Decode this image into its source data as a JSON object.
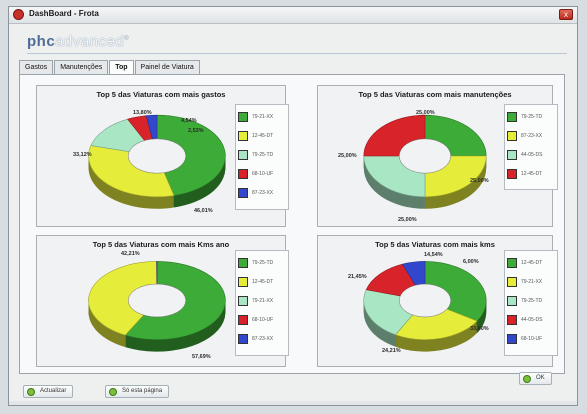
{
  "window": {
    "title": "DashBoard - Frota",
    "close_glyph": "x"
  },
  "logo": {
    "part1": "phc",
    "part2": "advanced",
    "mark": "®"
  },
  "tabs": [
    {
      "label": "Gastos",
      "active": false
    },
    {
      "label": "Manutenções",
      "active": false
    },
    {
      "label": "Top",
      "active": true
    },
    {
      "label": "Painel de Viatura",
      "active": false
    }
  ],
  "buttons": {
    "actualizar": "Actualizar",
    "so_esta_pagina": "Só esta página",
    "ok": "OK"
  },
  "icons": {
    "app": "app-logo-icon",
    "close": "close-icon",
    "button": "green-check-icon"
  },
  "chart_data": [
    {
      "type": "pie",
      "title": "Top 5 das Viaturas com mais gastos",
      "donut": true,
      "categories": [
        "79-21-XX",
        "12-45-DT",
        "79-25-TD",
        "68-10-UF",
        "87-23-XX"
      ],
      "values": [
        46.01,
        33.12,
        13.8,
        4.54,
        2.53
      ],
      "labels": [
        "46,01%",
        "33,12%",
        "13,80%",
        "4,54%",
        "2,53%"
      ],
      "colors": [
        "#3dab37",
        "#e6ec3a",
        "#a9e6c4",
        "#d8232a",
        "#3347cc"
      ],
      "legend_position": "right"
    },
    {
      "type": "pie",
      "title": "Top 5 das Viaturas com mais manutenções",
      "donut": true,
      "categories": [
        "79-25-TD",
        "87-23-XX",
        "44-05-DS",
        "12-45-DT"
      ],
      "values": [
        25.0,
        25.0,
        25.0,
        25.0
      ],
      "labels": [
        "25,00%",
        "25,00%",
        "25,00%",
        "25,00%"
      ],
      "colors": [
        "#3dab37",
        "#e6ec3a",
        "#a9e6c4",
        "#d8232a"
      ],
      "legend_position": "right"
    },
    {
      "type": "pie",
      "title": "Top 5 das Viaturas com mais Kms ano",
      "donut": true,
      "categories": [
        "79-25-TD",
        "12-45-DT",
        "79-21-XX",
        "68-10-UF",
        "87-23-XX"
      ],
      "values": [
        57.68,
        42.21,
        0.05,
        0.04,
        0.02
      ],
      "labels": [
        "57,69%",
        "42,21%",
        "",
        "",
        ""
      ],
      "colors": [
        "#3dab37",
        "#e6ec3a",
        "#a9e6c4",
        "#d8232a",
        "#3347cc"
      ],
      "legend_position": "right"
    },
    {
      "type": "pie",
      "title": "Top 5 das Viaturas com mais kms",
      "donut": true,
      "categories": [
        "12-45-DT",
        "79-21-XX",
        "79-25-TD",
        "44-05-DS",
        "68-10-UF"
      ],
      "values": [
        33.8,
        24.21,
        21.45,
        14.54,
        6.0
      ],
      "labels": [
        "33,80%",
        "24,21%",
        "21,45%",
        "14,54%",
        "6,00%"
      ],
      "colors": [
        "#3dab37",
        "#e6ec3a",
        "#a9e6c4",
        "#d8232a",
        "#3347cc"
      ],
      "legend_position": "right"
    }
  ]
}
